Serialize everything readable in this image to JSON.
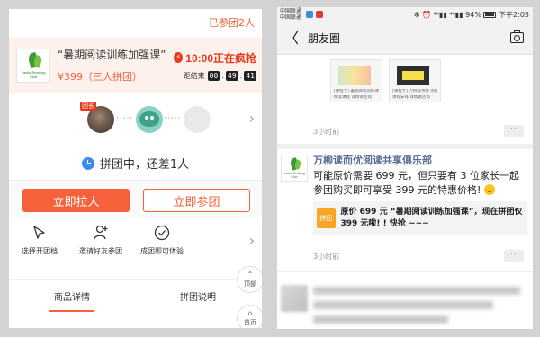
{
  "left": {
    "joined_text": "已参团2人",
    "product": {
      "logo_text": "Yanliu Reading Club",
      "title": "“暑期阅读训练加强课”",
      "price": "¥399（三人拼团）",
      "hot_icon": "⚡",
      "hot_text": "10:00正在疯抢",
      "countdown_label": "距结束",
      "countdown": [
        "00",
        "49",
        "41"
      ]
    },
    "members": {
      "leader_badge": "团长",
      "dots": "·····"
    },
    "status_text": "拼团中，还差1人",
    "buttons": {
      "invite": "立即拉人",
      "join": "立即参团"
    },
    "steps": [
      {
        "label": "选择开团档",
        "icon": "cursor-icon"
      },
      {
        "label": "邀请好友参团",
        "icon": "add-user-icon"
      },
      {
        "label": "成团即可体验",
        "icon": "check-circle-icon"
      }
    ],
    "floating": {
      "top_glyph": "⌃",
      "top_label": "顶部",
      "home_glyph": "⌂",
      "home_label": "首页"
    },
    "tabs": [
      "商品详情",
      "拼团说明"
    ]
  },
  "right": {
    "statusbar": {
      "carrier1": "中国联通",
      "carrier2": "中国联通",
      "right_text": "✻ ⏰ ⁴⁶▮▮ ⁴⁶▮▮ 94%",
      "time": "下午2:05"
    },
    "nav": {
      "back": "〈",
      "title": "朋友圈"
    },
    "prev_post": {
      "thumb_captions": [
        "[课程卡] 暑期阅读训练课程介绍",
        "精读课程 详情请咨询",
        "[课程卡] 万柳读书会 阅读书单推荐",
        "课程安排 详情请咨询"
      ],
      "time": "3小时前",
      "more": "··"
    },
    "post": {
      "author": "万柳读而优阅读共享俱乐部",
      "text": "可能原价需要 699 元，但只要有 3 位家长一起参团购买即可享受 399 元的特惠价格!",
      "link_tile": "拼团",
      "link_text": "原价 699 元 “暑期阅读训练加强课”，现在拼团仅 399 元啦! ! 快抢 ~~~",
      "time": "3小时前",
      "more": "··"
    }
  },
  "colors": {
    "accent": "#f5613a",
    "hot": "#e8391d",
    "wechat_link": "#576b95",
    "clock_blue": "#3d8ee9"
  }
}
